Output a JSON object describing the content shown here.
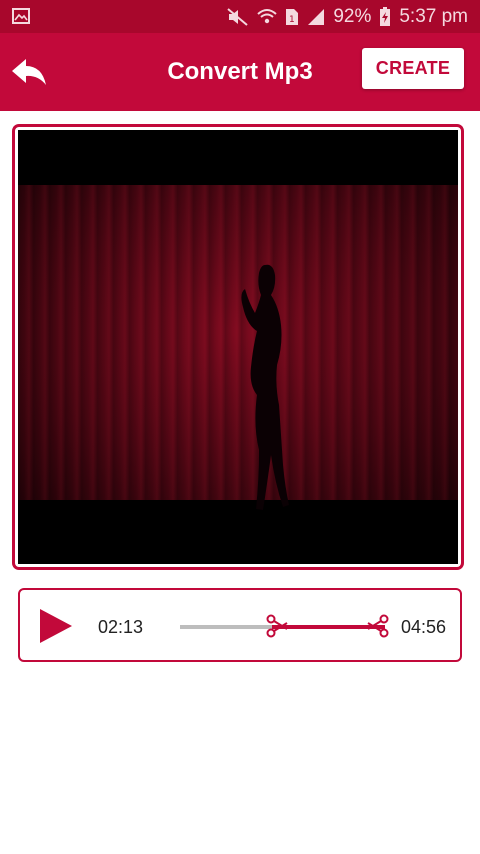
{
  "status_bar": {
    "battery_percent": "92%",
    "time": "5:37 pm",
    "icons": [
      "gallery-notification-icon",
      "mute-icon",
      "wifi-icon",
      "sim-1-icon",
      "signal-icon",
      "battery-charging-icon"
    ]
  },
  "app_bar": {
    "title": "Convert Mp3",
    "create_label": "CREATE",
    "back_icon": "back-arrow-icon"
  },
  "player": {
    "current_time": "02:13",
    "total_time": "04:56",
    "play_icon": "play-icon",
    "trim_start_fraction": 0.45,
    "trim_end_fraction": 1.0
  },
  "colors": {
    "primary": "#c2093a",
    "status_bar": "#a8072c",
    "track": "#bdbdbd"
  }
}
